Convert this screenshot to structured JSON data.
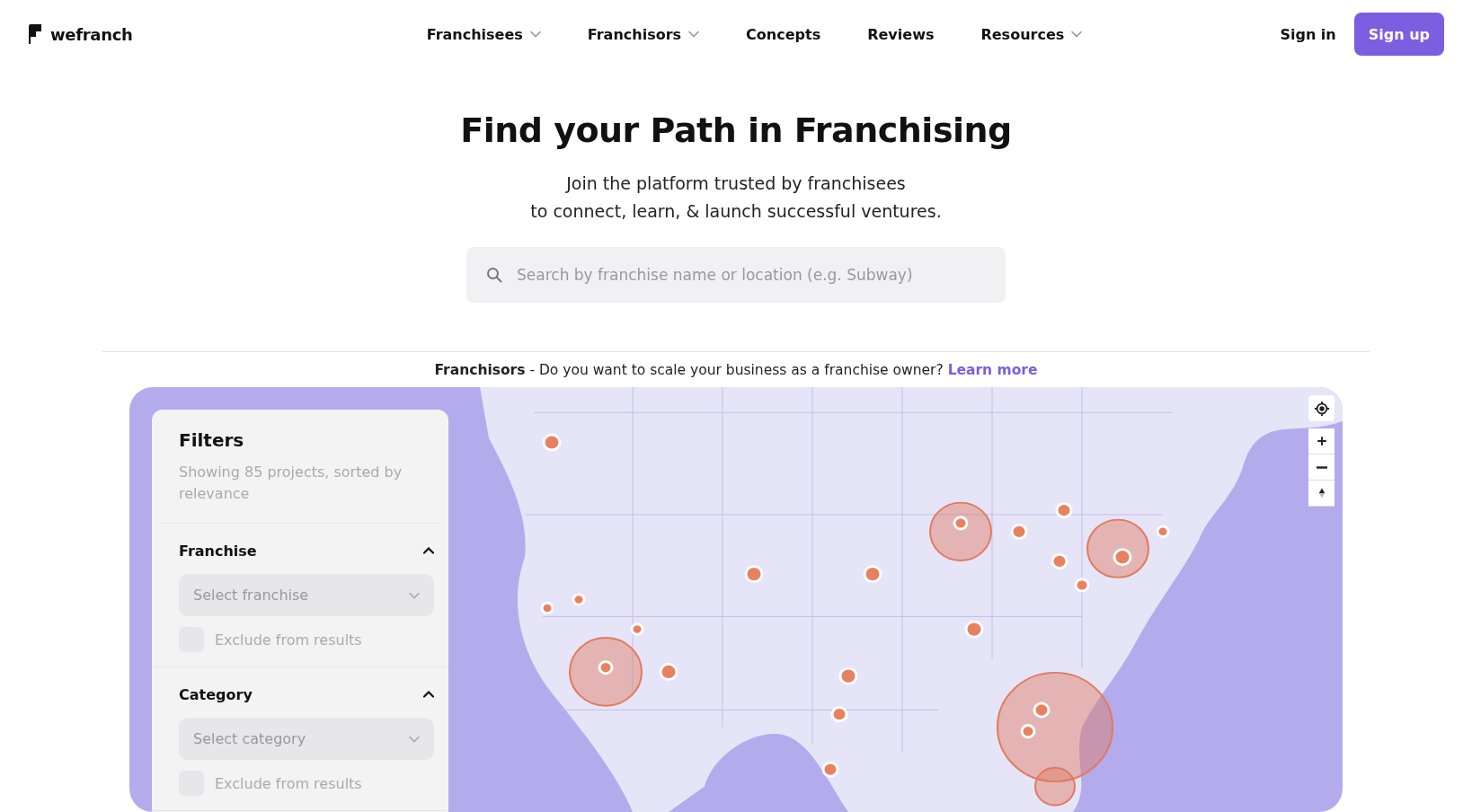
{
  "header": {
    "logo": "wefranch",
    "nav": [
      {
        "label": "Franchisees",
        "dropdown": true
      },
      {
        "label": "Franchisors",
        "dropdown": true
      },
      {
        "label": "Concepts",
        "dropdown": false
      },
      {
        "label": "Reviews",
        "dropdown": false
      },
      {
        "label": "Resources",
        "dropdown": true
      }
    ],
    "sign_in": "Sign in",
    "sign_up": "Sign up"
  },
  "hero": {
    "title": "Find your Path in Franchising",
    "subtitle_lines": [
      "Join the platform trusted by franchisees",
      "to connect, learn, & launch successful ventures."
    ],
    "search": {
      "placeholder": "Search by franchise name or location (e.g. Subway)"
    }
  },
  "franchisor_banner": {
    "text": "**Franchisors** - Do you want to scale your business as a franchise owner?",
    "link": "Learn more"
  },
  "filters": {
    "title": "Filters",
    "summary": "Showing 85 projects, sorted by relevance",
    "sections": [
      {
        "title": "Franchise",
        "expanded": true,
        "select": {
          "placeholder": "Select franchise"
        },
        "exclude": {
          "label": "Exclude from results",
          "checked": false
        }
      },
      {
        "title": "Category",
        "expanded": true,
        "select": {
          "placeholder": "Select category"
        },
        "exclude": {
          "label": "Exclude from results",
          "checked": false
        }
      }
    ]
  }
}
